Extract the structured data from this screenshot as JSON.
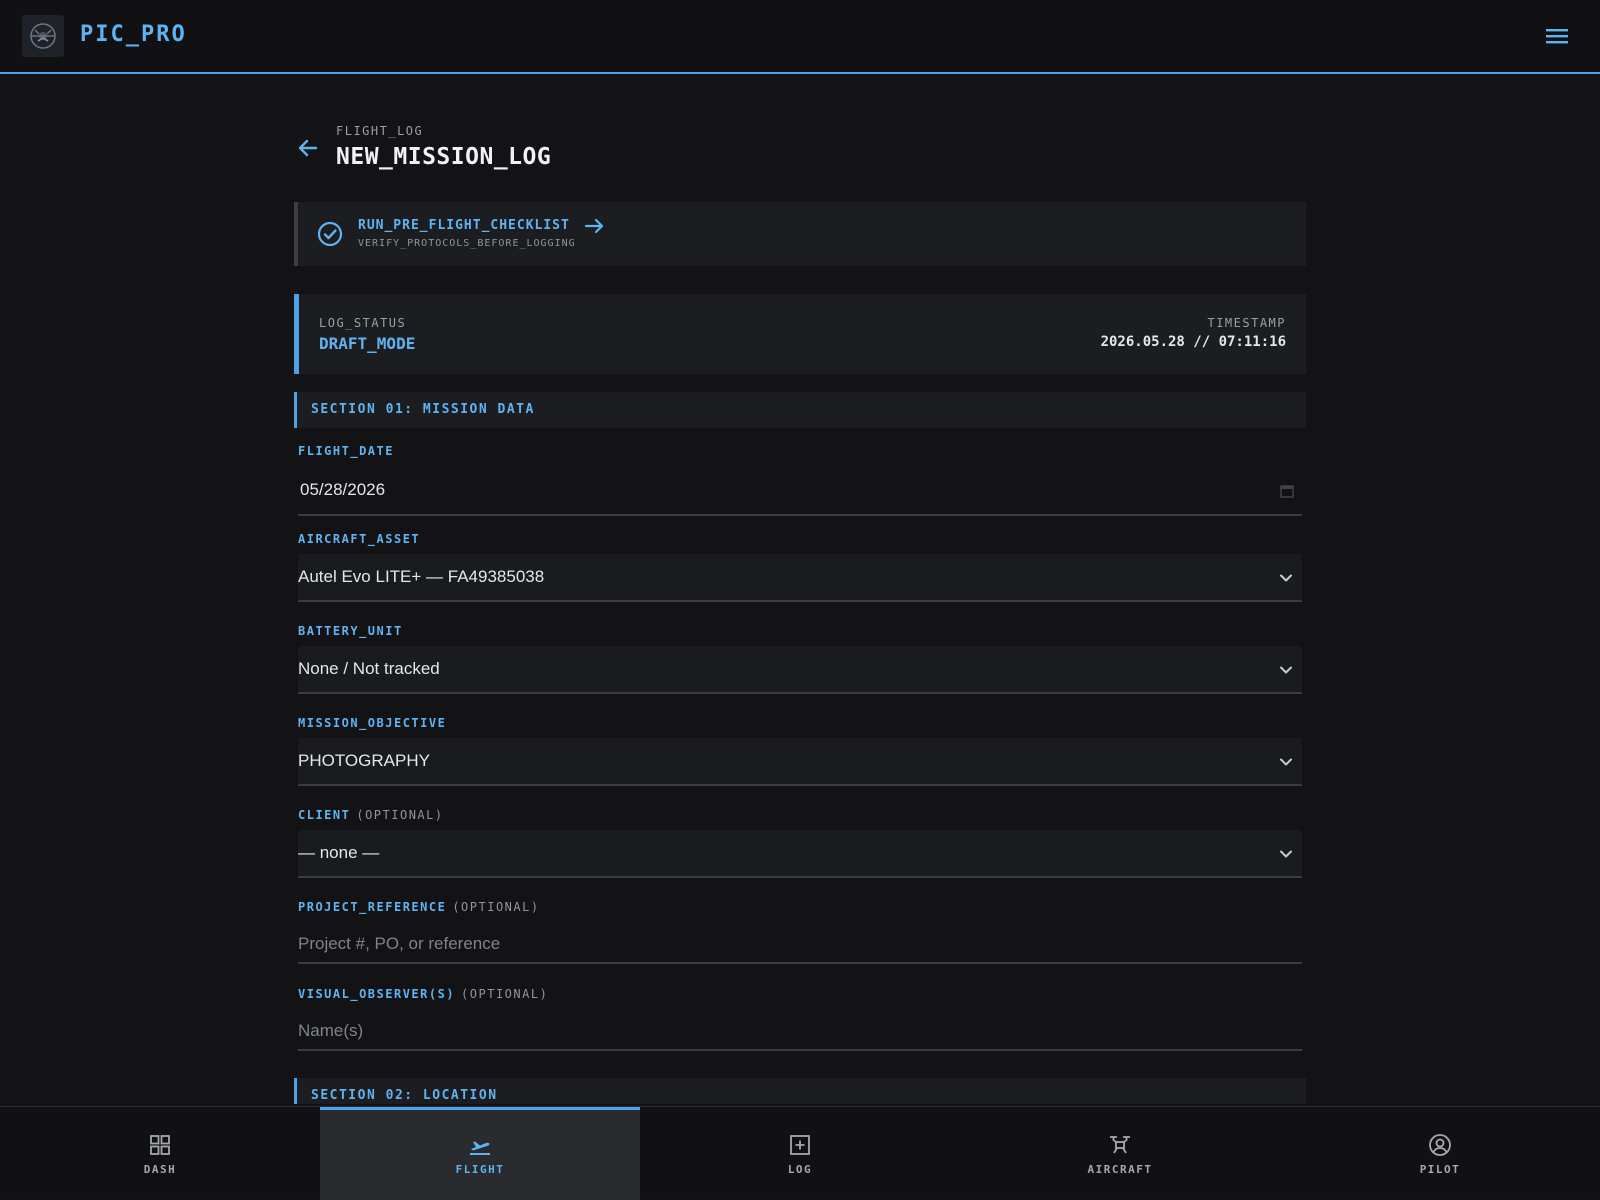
{
  "header": {
    "app_title": "PIC_PRO"
  },
  "page": {
    "breadcrumb": "FLIGHT_LOG",
    "title": "NEW_MISSION_LOG"
  },
  "checklist": {
    "title": "RUN_PRE_FLIGHT_CHECKLIST",
    "subtitle": "VERIFY_PROTOCOLS_BEFORE_LOGGING"
  },
  "status": {
    "label": "LOG_STATUS",
    "value": "DRAFT_MODE",
    "timestamp_label": "TIMESTAMP",
    "timestamp_value": "2026.05.28 // 07:11:16"
  },
  "sections": {
    "s1": "SECTION 01: MISSION DATA",
    "s2": "SECTION 02: LOCATION"
  },
  "fields": {
    "flight_date": {
      "label": "FLIGHT_DATE",
      "value": "05/28/2026"
    },
    "aircraft_asset": {
      "label": "AIRCRAFT_ASSET",
      "value": "Autel Evo LITE+ — FA49385038"
    },
    "battery_unit": {
      "label": "BATTERY_UNIT",
      "value": "None / Not tracked"
    },
    "mission_objective": {
      "label": "MISSION_OBJECTIVE",
      "value": "PHOTOGRAPHY"
    },
    "client": {
      "label": "CLIENT",
      "optional": "(OPTIONAL)",
      "value": "— none —"
    },
    "project_reference": {
      "label": "PROJECT_REFERENCE",
      "optional": "(OPTIONAL)",
      "placeholder": "Project #, PO, or reference"
    },
    "visual_observers": {
      "label": "VISUAL_OBSERVER(S)",
      "optional": "(OPTIONAL)",
      "placeholder": "Name(s)"
    }
  },
  "nav": [
    {
      "label": "DASH",
      "icon": "grid-icon",
      "active": false
    },
    {
      "label": "FLIGHT",
      "icon": "plane-takeoff-icon",
      "active": true
    },
    {
      "label": "LOG",
      "icon": "plus-square-icon",
      "active": false
    },
    {
      "label": "AIRCRAFT",
      "icon": "drone-icon",
      "active": false
    },
    {
      "label": "PILOT",
      "icon": "user-circle-icon",
      "active": false
    }
  ],
  "colors": {
    "accent": "#4aa3e8",
    "accent_text": "#5fb3f0",
    "background": "#131316",
    "card": "#1c1d21"
  }
}
